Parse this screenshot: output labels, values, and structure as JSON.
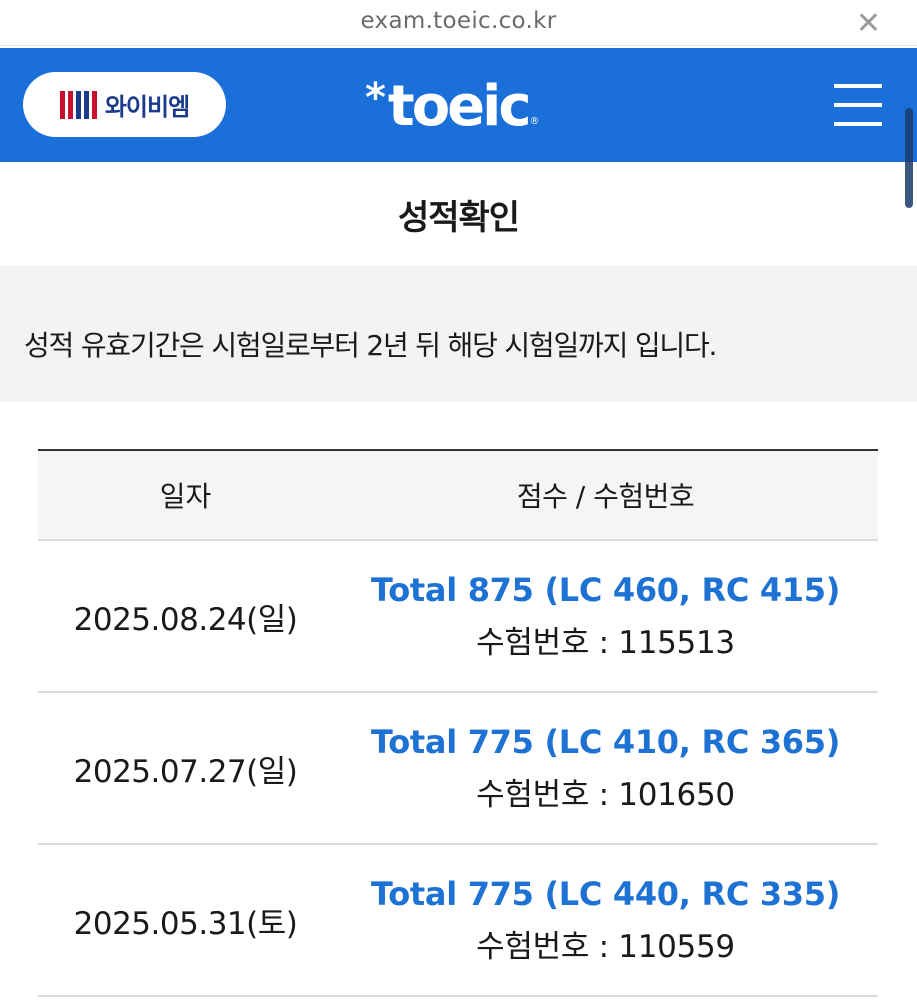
{
  "browser": {
    "url": "exam.toeic.co.kr",
    "close_icon": "close-icon"
  },
  "header": {
    "brand_label": "와이비엠",
    "logo_text": "toeic",
    "logo_star": "*",
    "menu_icon": "hamburger-menu-icon",
    "background_color": "#1a6fd8"
  },
  "page": {
    "title": "성적확인",
    "notice": "성적 유효기간은 시험일로부터 2년 뒤 해당 시험일까지 입니다."
  },
  "table": {
    "columns": [
      "일자",
      "점수 / 수험번호"
    ],
    "rows": [
      {
        "date": "2025.08.24(일)",
        "total": "Total 875 (LC 460, RC 415)",
        "exam_number": "수험번호 : 115513"
      },
      {
        "date": "2025.07.27(일)",
        "total": "Total 775 (LC 410, RC 365)",
        "exam_number": "수험번호 : 101650"
      },
      {
        "date": "2025.05.31(토)",
        "total": "Total 775 (LC 440, RC 335)",
        "exam_number": "수험번호 : 110559"
      }
    ],
    "link_color": "#1d72d3"
  }
}
